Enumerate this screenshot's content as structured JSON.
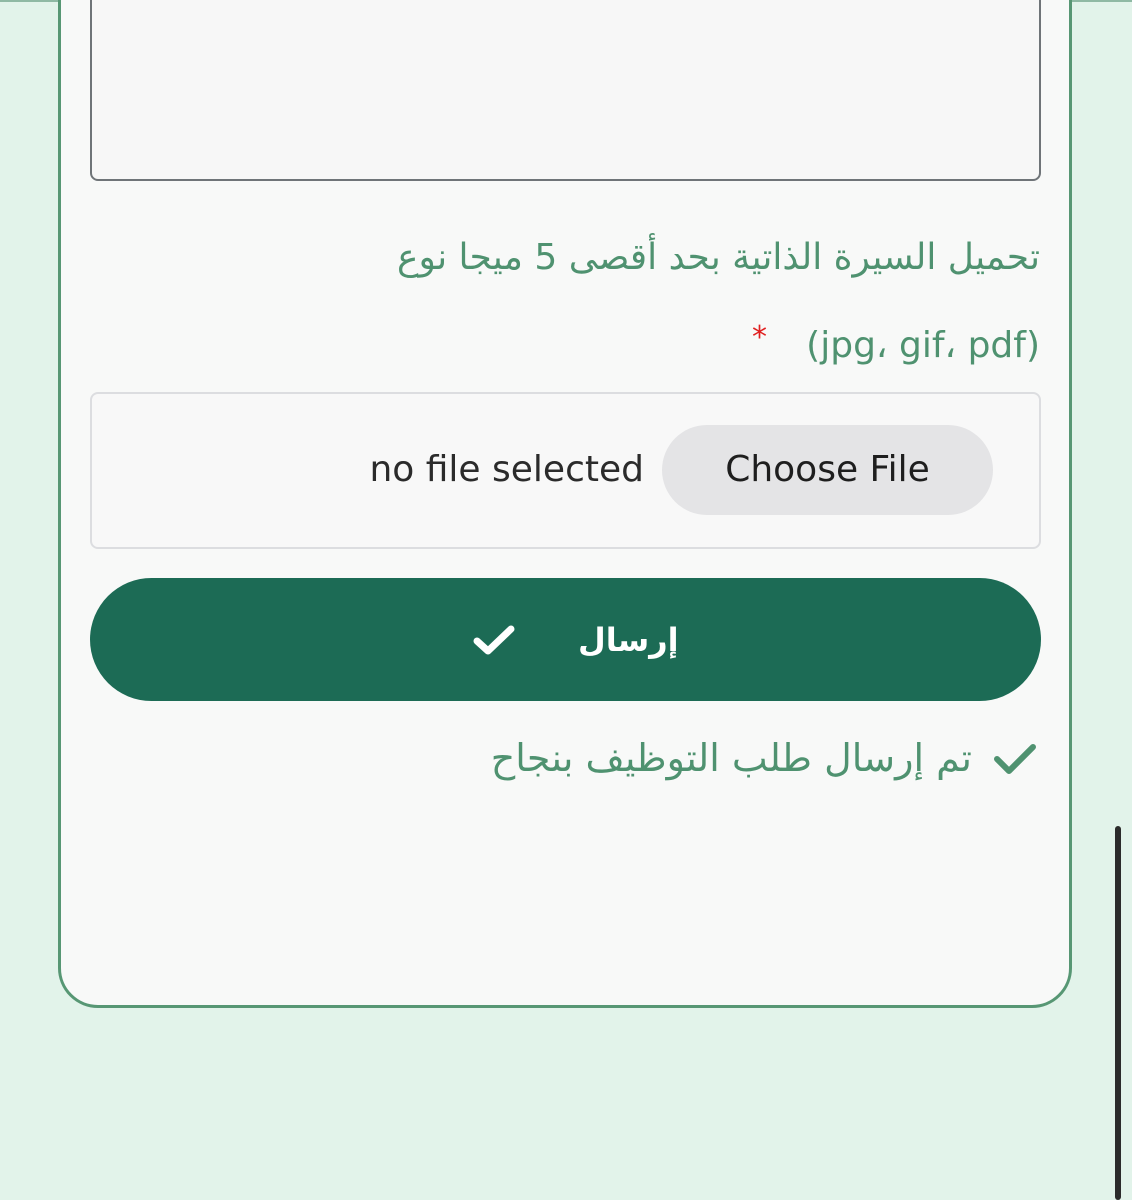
{
  "form": {
    "textarea_value": "",
    "upload_label_line1": "تحميل السيرة الذاتية بحد أقصى 5 ميجا نوع",
    "upload_label_line2": "(jpg، gif، pdf)",
    "required_marker": "*",
    "choose_file_label": "Choose File",
    "no_file_text": "no file selected",
    "submit_label": "إرسال",
    "success_message": "تم إرسال طلب التوظيف بنجاح"
  },
  "icons": {
    "submit_icon": "check-icon",
    "success_icon": "check-icon"
  },
  "colors": {
    "page_background": "#e2f3ea",
    "card_border": "#579774",
    "label_text": "#4f9270",
    "required_star": "#e02020",
    "submit_background": "#1c6b55",
    "choose_file_background": "#e4e4e6"
  }
}
